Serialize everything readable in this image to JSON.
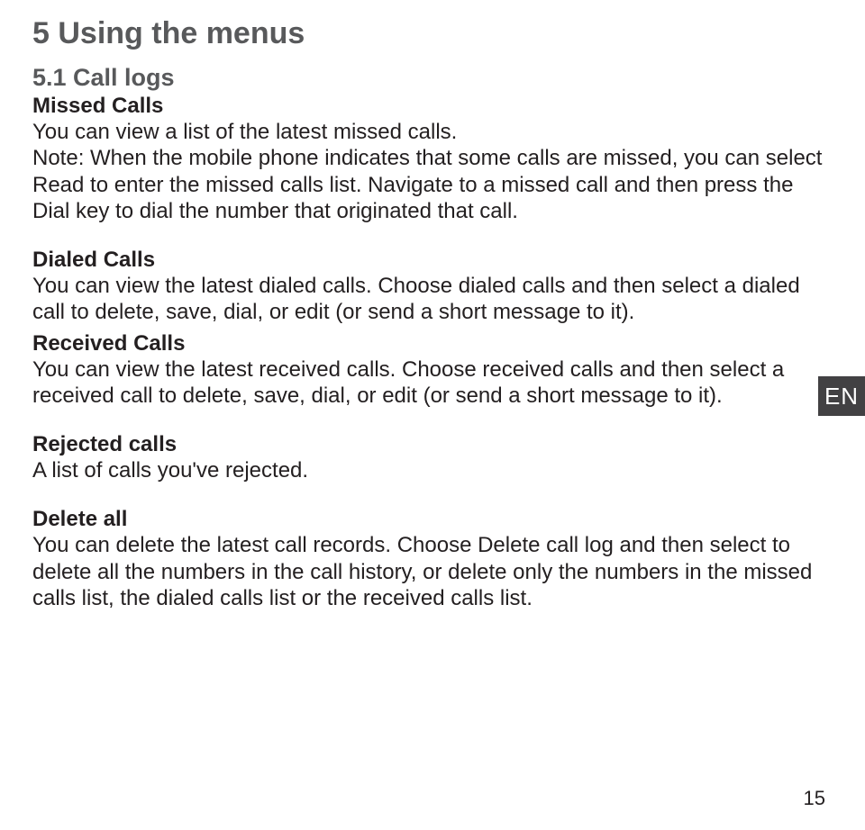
{
  "chapterTitle": "5 Using the menus",
  "section": {
    "title": "5.1 Call logs",
    "missed": {
      "heading": "Missed Calls",
      "body": "You can view a list of the latest missed calls.\nNote: When the mobile phone indicates that some calls are missed, you can select Read to enter the missed calls list. Navigate to a missed call and then press the Dial key to dial the number that originated that call."
    },
    "dialed": {
      "heading": "Dialed Calls",
      "body": "You can view the latest dialed calls. Choose dialed calls and then select a dialed call to delete, save, dial, or edit (or send a short message to it)."
    },
    "received": {
      "heading": "Received Calls",
      "body": "You can view the latest received calls. Choose received calls and then select a received call to delete, save, dial, or edit (or send a short message to it)."
    },
    "rejected": {
      "heading": "Rejected calls",
      "body": "A list of calls you've rejected."
    },
    "deleteAll": {
      "heading": "Delete all",
      "body": "You can delete the latest call records. Choose Delete call log and then select to delete all the numbers in the call history, or delete only the numbers in the missed calls list, the dialed calls list or the received calls list."
    }
  },
  "languageTab": "EN",
  "pageNumber": "15"
}
